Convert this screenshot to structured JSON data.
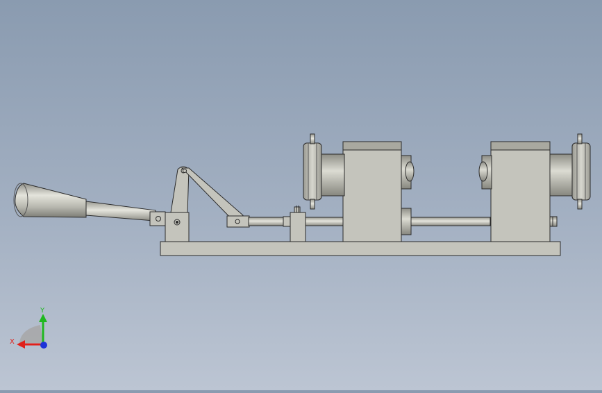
{
  "viewport": {
    "background_top": "#8a9bb0",
    "background_bottom": "#bcc5d3",
    "part_fill": "#c4c4bc",
    "part_dark": "#a9a9a0",
    "edge_color": "#2a2a2a"
  },
  "triad": {
    "x_label": "X",
    "y_label": "Y",
    "x_color": "#e0201a",
    "y_color": "#1fb81f",
    "z_color": "#1d34d8"
  }
}
